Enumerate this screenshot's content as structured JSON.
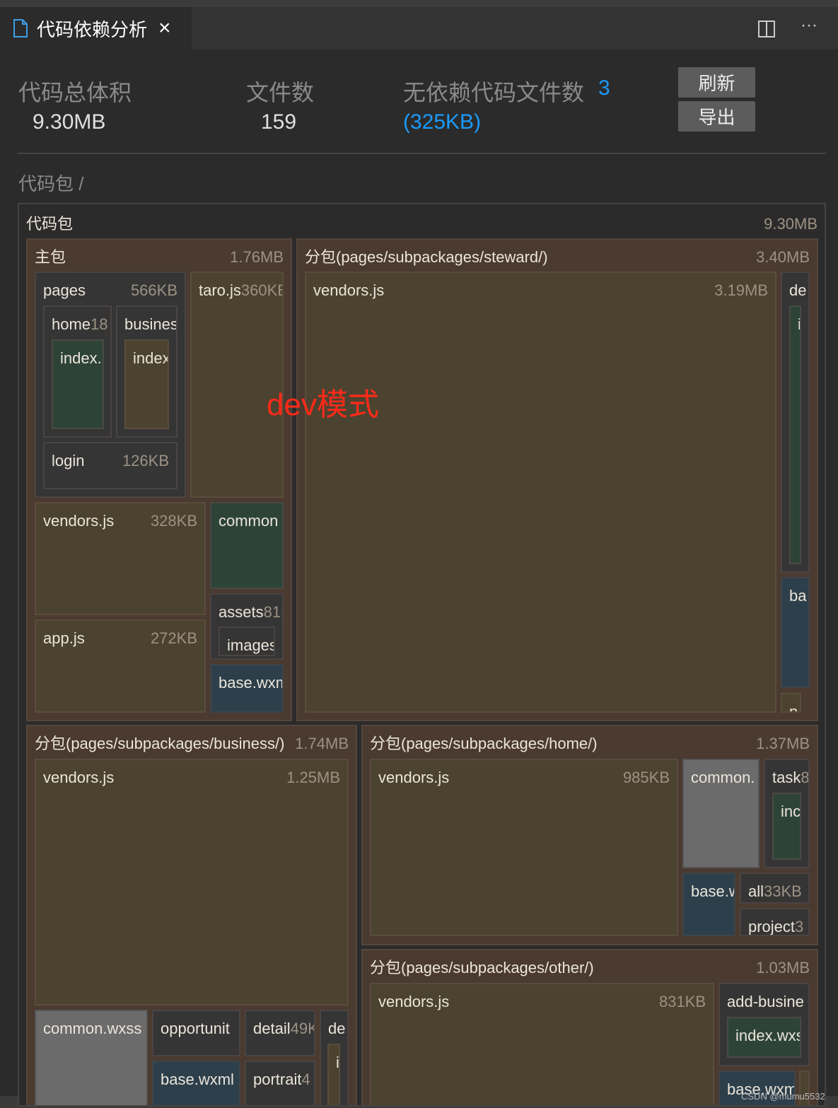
{
  "tab": {
    "title": "代码依赖分析",
    "icon": "file-icon",
    "close": "×"
  },
  "toolbar": {
    "split_icon": "split-editor-icon",
    "more": "···"
  },
  "stats": {
    "total_label": "代码总体积",
    "total_value": "9.30MB",
    "files_label": "文件数",
    "files_value": "159",
    "nodep_label": "无依赖代码文件数",
    "nodep_count": "3",
    "nodep_size": "(325KB)"
  },
  "buttons": {
    "refresh": "刷新",
    "export": "导出"
  },
  "breadcrumb": "代码包 /",
  "annotation": "dev模式",
  "watermark": "CSDN @mumu5532",
  "colors": {
    "accent": "#1a9bfc",
    "annotation": "#ff2a1a",
    "package": "#4a3a30",
    "js": "#4b432f",
    "wxss": "#2e4338",
    "wxml": "#2d3f4b",
    "dir": "#353535"
  },
  "treemap": {
    "name": "代码包",
    "size": "9.30MB",
    "kind": "root",
    "children": [
      {
        "name": "主包",
        "size": "1.76MB",
        "kind": "pkg",
        "children": [
          {
            "name": "pages",
            "size": "566KB",
            "kind": "dir",
            "children": [
              {
                "name": "home",
                "size": "18",
                "kind": "dir",
                "children": [
                  {
                    "name": "index.",
                    "size": "",
                    "kind": "green"
                  }
                ]
              },
              {
                "name": "busines",
                "size": "",
                "kind": "dir",
                "children": [
                  {
                    "name": "index",
                    "size": "",
                    "kind": "js"
                  }
                ]
              },
              {
                "name": "login",
                "size": "126KB",
                "kind": "dir"
              }
            ]
          },
          {
            "name": "taro.js",
            "size": "360KB",
            "kind": "js"
          },
          {
            "name": "vendors.js",
            "size": "328KB",
            "kind": "js"
          },
          {
            "name": "app.js",
            "size": "272KB",
            "kind": "js"
          },
          {
            "name": "common",
            "size": "",
            "kind": "green"
          },
          {
            "name": "assets",
            "size": "81KB",
            "kind": "dir",
            "children": [
              {
                "name": "images",
                "size": "",
                "kind": "dir"
              }
            ]
          },
          {
            "name": "base.wxml",
            "size": "",
            "kind": "blue"
          }
        ]
      },
      {
        "name": "分包(pages/subpackages/steward/)",
        "size": "3.40MB",
        "kind": "pkg",
        "children": [
          {
            "name": "vendors.js",
            "size": "3.19MB",
            "kind": "js"
          },
          {
            "name": "de",
            "size": "",
            "kind": "dir",
            "children": [
              {
                "name": "i",
                "size": "",
                "kind": "green"
              }
            ]
          },
          {
            "name": "ba",
            "size": "",
            "kind": "blue"
          },
          {
            "name": "n",
            "size": "",
            "kind": "js"
          }
        ]
      },
      {
        "name": "分包(pages/subpackages/business/)",
        "size": "1.74MB",
        "kind": "pkg",
        "children": [
          {
            "name": "vendors.js",
            "size": "1.25MB",
            "kind": "js"
          },
          {
            "name": "common.wxss",
            "size": "",
            "kind": "light"
          },
          {
            "name": "opportunit",
            "size": "",
            "kind": "dir"
          },
          {
            "name": "base.wxml",
            "size": "",
            "kind": "blue"
          },
          {
            "name": "detail",
            "size": "49KB",
            "kind": "dir"
          },
          {
            "name": "portrait",
            "size": "4",
            "kind": "dir"
          },
          {
            "name": "de",
            "size": "",
            "kind": "dir",
            "children": [
              {
                "name": "i",
                "size": "",
                "kind": "js"
              }
            ]
          }
        ]
      },
      {
        "name": "分包(pages/subpackages/home/)",
        "size": "1.37MB",
        "kind": "pkg",
        "children": [
          {
            "name": "vendors.js",
            "size": "985KB",
            "kind": "js"
          },
          {
            "name": "common.",
            "size": "",
            "kind": "light"
          },
          {
            "name": "task",
            "size": "8",
            "kind": "dir",
            "children": [
              {
                "name": "inc",
                "size": "",
                "kind": "green"
              }
            ]
          },
          {
            "name": "base.w",
            "size": "",
            "kind": "blue"
          },
          {
            "name": "all",
            "size": "33KB",
            "kind": "dir"
          },
          {
            "name": "project",
            "size": "3",
            "kind": "dir"
          }
        ]
      },
      {
        "name": "分包(pages/subpackages/other/)",
        "size": "1.03MB",
        "kind": "pkg",
        "children": [
          {
            "name": "vendors.js",
            "size": "831KB",
            "kind": "js"
          },
          {
            "name": "add-busine",
            "size": "",
            "kind": "dir",
            "children": [
              {
                "name": "index.wxss",
                "size": "",
                "kind": "green"
              }
            ]
          },
          {
            "name": "base.wxml",
            "size": "",
            "kind": "blue"
          },
          {
            "name": "l",
            "size": "",
            "kind": "js"
          }
        ]
      }
    ]
  }
}
